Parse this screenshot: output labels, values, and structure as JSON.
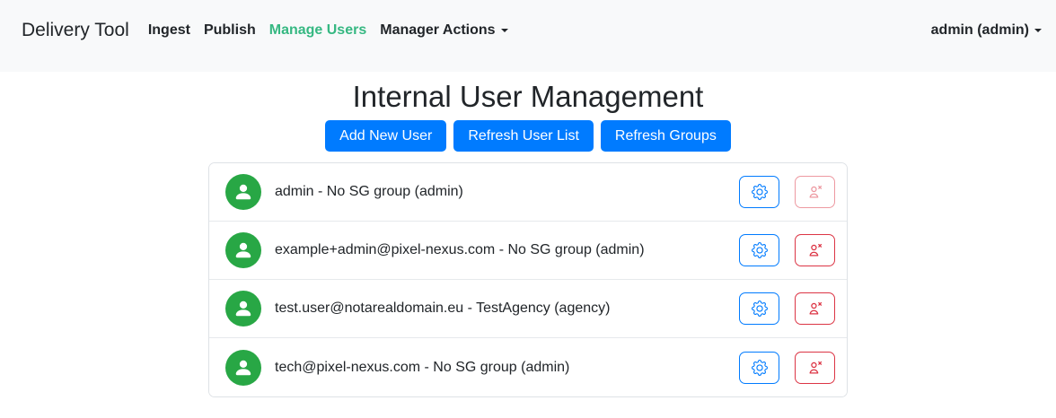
{
  "navbar": {
    "brand": "Delivery Tool",
    "links": [
      {
        "label": "Ingest",
        "active": false,
        "has_dropdown": false
      },
      {
        "label": "Publish",
        "active": false,
        "has_dropdown": false
      },
      {
        "label": "Manage Users",
        "active": true,
        "has_dropdown": false
      },
      {
        "label": "Manager Actions",
        "active": false,
        "has_dropdown": true
      }
    ],
    "user_menu": {
      "label": "admin (admin)",
      "has_dropdown": true
    }
  },
  "page": {
    "title": "Internal User Management",
    "toolbar": {
      "add_new_user": "Add New User",
      "refresh_user_list": "Refresh User List",
      "refresh_groups": "Refresh Groups"
    },
    "users": [
      {
        "label": "admin - No SG group (admin)",
        "delete_disabled": true
      },
      {
        "label": "example+admin@pixel-nexus.com - No SG group (admin)",
        "delete_disabled": false
      },
      {
        "label": "test.user@notarealdomain.eu - TestAgency (agency)",
        "delete_disabled": false
      },
      {
        "label": "tech@pixel-nexus.com - No SG group (admin)",
        "delete_disabled": false
      }
    ]
  },
  "icons": {
    "caret-down-icon": "▾ solid triangle dropdown indicator",
    "person-icon": "white filled user silhouette in green circle",
    "gear-icon": "blue outline settings gear",
    "person-x-icon": "red outline person with small x (remove user)"
  },
  "colors": {
    "navbar_bg": "#f8f9fa",
    "nav_active_green": "#36b882",
    "primary_blue": "#007bff",
    "danger_red": "#dc3545",
    "avatar_green": "#28a745",
    "text": "#212529",
    "list_border": "#dee2e6"
  }
}
